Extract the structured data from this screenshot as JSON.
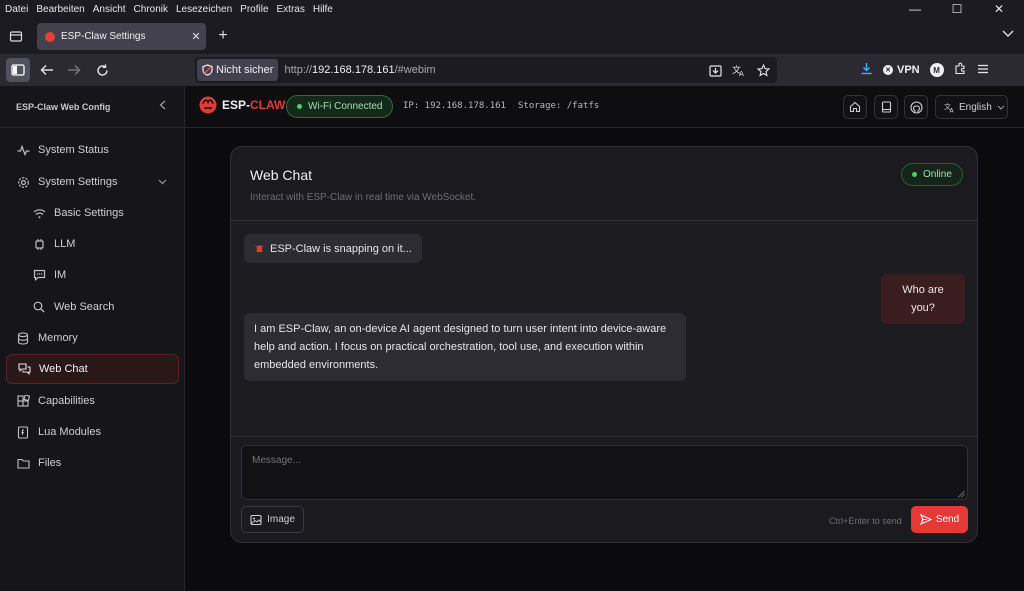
{
  "os_menu": [
    "Datei",
    "Bearbeiten",
    "Ansicht",
    "Chronik",
    "Lesezeichen",
    "Profile",
    "Extras",
    "Hilfe"
  ],
  "window_controls": {
    "minimize": "—",
    "maximize": "☐",
    "close": "✕"
  },
  "browser": {
    "tab_title": "ESP-Claw Settings",
    "tab_close": "✕",
    "new_tab": "+",
    "security_label": "Nicht sicher",
    "url_scheme": "http://",
    "url_host": "192.168.178.161",
    "url_path": "/#webim",
    "vpn_label": "VPN",
    "account_initial": "M"
  },
  "sidebar": {
    "header": "ESP-Claw Web Config",
    "items": [
      {
        "label": "System Status",
        "icon": "activity-icon"
      },
      {
        "label": "System Settings",
        "icon": "gear-icon"
      },
      {
        "label": "Basic Settings",
        "icon": "wifi-icon"
      },
      {
        "label": "LLM",
        "icon": "chip-icon"
      },
      {
        "label": "IM",
        "icon": "message-icon"
      },
      {
        "label": "Web Search",
        "icon": "search-icon"
      },
      {
        "label": "Memory",
        "icon": "database-icon"
      },
      {
        "label": "Web Chat",
        "icon": "chat-icon"
      },
      {
        "label": "Capabilities",
        "icon": "blocks-icon"
      },
      {
        "label": "Lua Modules",
        "icon": "script-icon"
      },
      {
        "label": "Files",
        "icon": "folder-icon"
      }
    ]
  },
  "topbar": {
    "logo_prefix": "ESP-",
    "logo_suffix": "CLAW",
    "wifi_status": "Wi-Fi Connected",
    "ip_text": "IP: 192.168.178.161",
    "storage_text": "Storage: /fatfs",
    "language": "English"
  },
  "chat": {
    "title": "Web Chat",
    "subtitle": "Interact with ESP-Claw in real time via WebSocket.",
    "status": "Online",
    "typing": "ESP-Claw is snapping on it...",
    "user_message": "Who are you?",
    "bot_message": "I am ESP-Claw, an on-device AI agent designed to turn user intent into device-aware help and action. I focus on practical orchestration, tool use, and execution within embedded environments.",
    "input_placeholder": "Message...",
    "image_label": "Image",
    "hint": "Ctrl+Enter to send",
    "send_label": "Send"
  },
  "colors": {
    "accent": "#e53935",
    "online": "#4ccf6c",
    "active_bg": "#2a1717"
  }
}
